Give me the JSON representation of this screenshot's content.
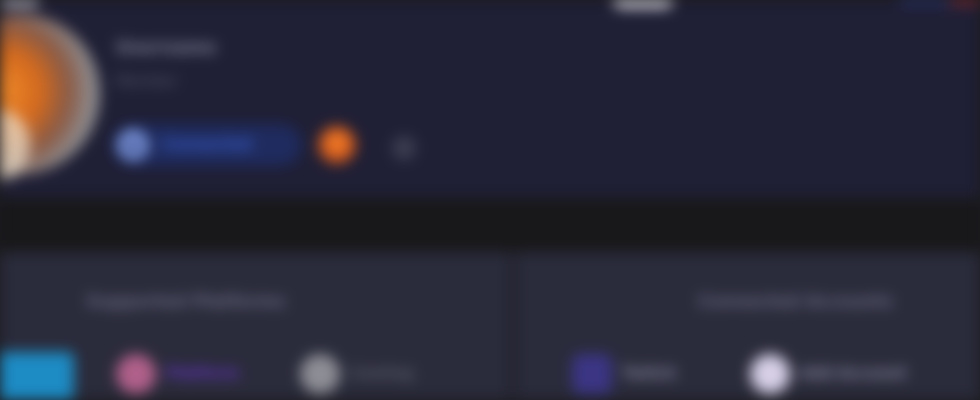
{
  "profile": {
    "name": "Username",
    "subtitle": "Member",
    "platform_label": "Connected",
    "icons": {
      "avatar": "user-avatar",
      "platform": "platform-logo-icon",
      "fox": "metamask-fox-icon",
      "extra": "more-icon"
    }
  },
  "panels": {
    "left": {
      "heading": "Supported Platforms",
      "chips": [
        {
          "label": "Platform",
          "icon": "platform-icon"
        },
        {
          "label": "Coming",
          "icon": "coming-soon-icon"
        }
      ]
    },
    "right": {
      "heading": "Connected Accounts",
      "chips": [
        {
          "label": "Twitch",
          "icon": "twitch-icon"
        },
        {
          "label": "Add Account",
          "icon": "add-account-icon"
        }
      ]
    }
  },
  "colors": {
    "header_bg": "#1f1f35",
    "divider_bg": "#18181a",
    "panel_bg": "#2a2b3b",
    "accent_blue": "#3c63d8",
    "accent_purple": "#6a35c9",
    "accent_cyan": "#1d8bc4",
    "fox_orange": "#ff8c2a"
  }
}
